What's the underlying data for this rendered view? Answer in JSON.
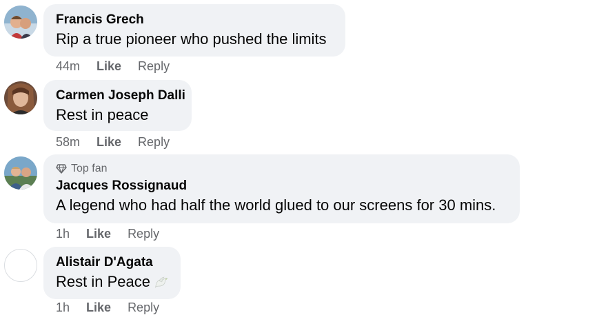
{
  "comments": [
    {
      "author": "Francis Grech",
      "text": "Rip a true pioneer who pushed the limits",
      "time": "44m",
      "like_label": "Like",
      "reply_label": "Reply"
    },
    {
      "author": "Carmen Joseph Dalli",
      "text": "Rest in peace",
      "time": "58m",
      "like_label": "Like",
      "reply_label": "Reply"
    },
    {
      "badge": "Top fan",
      "author": "Jacques Rossignaud",
      "text": "A legend who had half the world glued to our screens for 30 mins.",
      "time": "1h",
      "like_label": "Like",
      "reply_label": "Reply"
    },
    {
      "author": "Alistair D'Agata",
      "text": "Rest in Peace",
      "emoji_icon": "dove-icon",
      "time": "1h",
      "like_label": "Like",
      "reply_label": "Reply"
    }
  ],
  "colors": {
    "bubble_bg": "#f0f2f5",
    "meta_text": "#65676b",
    "primary_text": "#050505"
  }
}
